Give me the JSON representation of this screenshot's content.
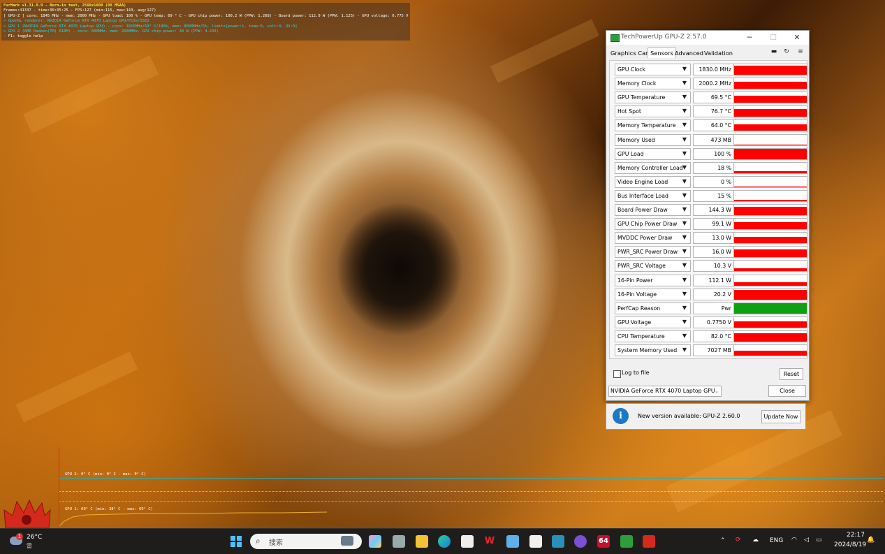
{
  "furmark": {
    "lines": [
      "FurMark v1.31.0.0 - Burn-in test, 2560x1600 (0X MSAA)",
      "Frames:41337 - time:00:05:25 - FPS:127 (min:115, max:143, avg:127)",
      "[ GPU-Z ] core: 1845 MHz - mem: 2000 MHz - GPU load: 100 % - GPU temp: 69 ° C - GPU chip power: 100.2 W (PPW: 1.268) - Board power: 112.9 W (PPW: 1.125) - GPU voltage: 0.775 V",
      "> OpenGL renderer: NVIDIA GeForce RTX 4070 Laptop GPU/PCIe/SSE2",
      "> GPU 1 (NVIDIA GeForce RTX 4070 Laptop GPU) - core: 1815MHz/69° C/100%, mem: 8000MHz/5%, limits[power:1, temp:0, volt:0, OV:0]",
      "> GPU 2 (AMD Radeon(TM) 610M) - core: 600MHz, mem: 2600MHz, GPU chip power: 30 W (PPW: 4.233)",
      "- F1: toggle help"
    ],
    "graph_gpu2": "GPU 2: 0° C (min: 0° C - max: 0° C)",
    "graph_gpu1": "GPU 1: 69° C (min: 38° C - max: 69° C)"
  },
  "gpuz": {
    "title": "TechPowerUp GPU-Z 2.57.0",
    "tabs": [
      "Graphics Card",
      "Sensors",
      "Advanced",
      "Validation"
    ],
    "active_tab": "Sensors",
    "sensors": [
      {
        "name": "GPU Clock",
        "value": "1830.0 MHz",
        "level": 0.9,
        "color": "#ff0000"
      },
      {
        "name": "Memory Clock",
        "value": "2000.2 MHz",
        "level": 0.7,
        "color": "#ff0000"
      },
      {
        "name": "GPU Temperature",
        "value": "69.5 °C",
        "level": 0.7,
        "color": "#ff0000"
      },
      {
        "name": "Hot Spot",
        "value": "76.7 °C",
        "level": 0.75,
        "color": "#ff0000"
      },
      {
        "name": "Memory Temperature",
        "value": "64.0 °C",
        "level": 0.6,
        "color": "#ff0000"
      },
      {
        "name": "Memory Used",
        "value": "473 MB",
        "level": 0.06,
        "color": "#ff0000"
      },
      {
        "name": "GPU Load",
        "value": "100 %",
        "level": 1.0,
        "color": "#ff0000"
      },
      {
        "name": "Memory Controller Load",
        "value": "18 %",
        "level": 0.18,
        "color": "#ff0000"
      },
      {
        "name": "Video Engine Load",
        "value": "0 %",
        "level": 0.0,
        "color": "#ff0000"
      },
      {
        "name": "Bus Interface Load",
        "value": "15 %",
        "level": 0.15,
        "color": "#ff0000"
      },
      {
        "name": "Board Power Draw",
        "value": "144.3 W",
        "level": 0.8,
        "color": "#ff0000"
      },
      {
        "name": "GPU Chip Power Draw",
        "value": "99.1 W",
        "level": 0.7,
        "color": "#ff0000"
      },
      {
        "name": "MVDDC Power Draw",
        "value": "13.0 W",
        "level": 0.6,
        "color": "#ff0000"
      },
      {
        "name": "PWR_SRC Power Draw",
        "value": "16.0 W",
        "level": 0.75,
        "color": "#ff0000"
      },
      {
        "name": "PWR_SRC Voltage",
        "value": "10.3 V",
        "level": 0.3,
        "color": "#ff0000"
      },
      {
        "name": "16-Pin Power",
        "value": "112.1 W",
        "level": 0.3,
        "color": "#ff0000"
      },
      {
        "name": "16-Pin Voltage",
        "value": "20.2 V",
        "level": 0.9,
        "color": "#ff0000"
      },
      {
        "name": "PerfCap Reason",
        "value": "Pwr",
        "level": 1.0,
        "color": "#0fa012"
      },
      {
        "name": "GPU Voltage",
        "value": "0.7750 V",
        "level": 0.6,
        "color": "#ff0000"
      },
      {
        "name": "CPU Temperature",
        "value": "82.0 °C",
        "level": 0.8,
        "color": "#ff0000"
      },
      {
        "name": "System Memory Used",
        "value": "7027 MB",
        "level": 0.5,
        "color": "#ff0000"
      }
    ],
    "log_to_file": "Log to file",
    "reset": "Reset",
    "device": "NVIDIA GeForce RTX 4070 Laptop GPU",
    "close": "Close"
  },
  "update": {
    "message": "New version available: GPU-Z 2.60.0",
    "button": "Update Now"
  },
  "taskbar": {
    "weather_temp": "26°C",
    "weather_desc": "雷",
    "weather_badge": "1",
    "search_placeholder": "搜索",
    "lang": "ENG",
    "time": "22:17",
    "date": "2024/8/19",
    "app64": "64"
  }
}
